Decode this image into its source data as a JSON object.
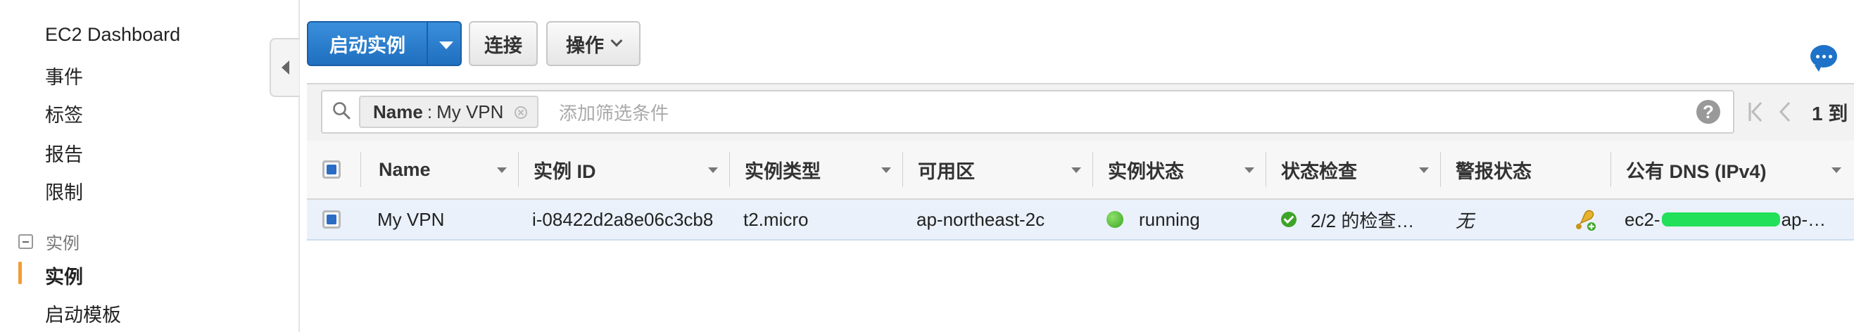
{
  "sidebar": {
    "items": [
      {
        "label": "EC2 Dashboard"
      },
      {
        "label": "事件"
      },
      {
        "label": "标签"
      },
      {
        "label": "报告"
      },
      {
        "label": "限制"
      }
    ],
    "group": {
      "label": "实例"
    },
    "group_items": [
      {
        "label": "实例",
        "active": true
      },
      {
        "label": "启动模板"
      }
    ],
    "accent_color": "#f39c35"
  },
  "toolbar": {
    "launch_label": "启动实例",
    "connect_label": "连接",
    "actions_label": "操作",
    "primary_color": "#2b7bd0"
  },
  "filter": {
    "chip_key": "Name",
    "chip_sep": ":",
    "chip_value": "My VPN",
    "placeholder": "添加筛选条件",
    "help_label": "?",
    "pager_text": "1 到"
  },
  "table": {
    "columns": [
      "Name",
      "实例 ID",
      "实例类型",
      "可用区",
      "实例状态",
      "状态检查",
      "警报状态",
      "公有 DNS (IPv4)"
    ],
    "rows": [
      {
        "name": "My VPN",
        "instance_id": "i-08422d2a8e06c3cb8",
        "instance_type": "t2.micro",
        "availability_zone": "ap-northeast-2c",
        "instance_state": "running",
        "status_check": "2/2 的检查…",
        "alarm_status": "无",
        "dns_prefix": "ec2-",
        "dns_suffix": "ap-…"
      }
    ]
  },
  "icons": {
    "search": "search-icon",
    "chat": "chat-icon",
    "help": "help-icon",
    "alarm": "alarm-bell-icon"
  }
}
